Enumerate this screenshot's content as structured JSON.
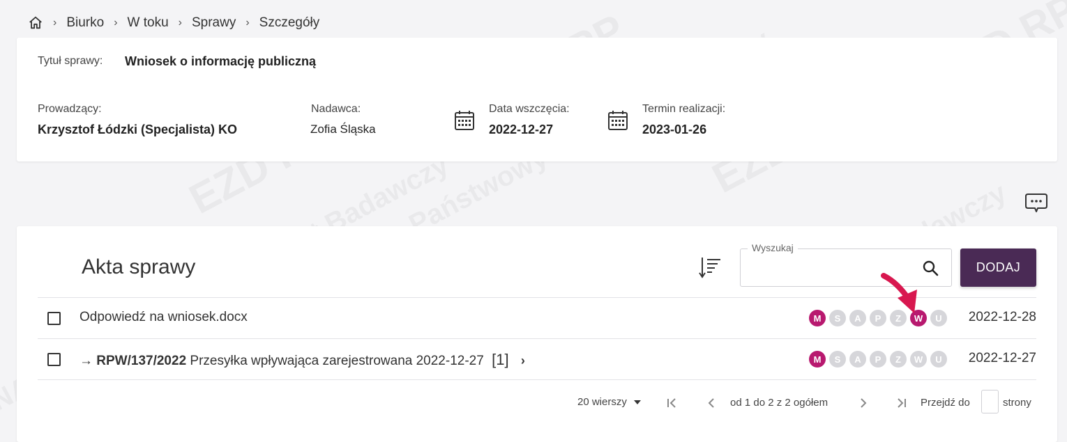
{
  "breadcrumb": {
    "items": [
      "Biurko",
      "W toku",
      "Sprawy",
      "Szczegóły"
    ]
  },
  "case": {
    "title_label": "Tytuł sprawy:",
    "title_value": "Wniosek o informację publiczną",
    "lead_label": "Prowadzący:",
    "lead_value": "Krzysztof Łódzki (Specjalista) KO",
    "sender_label": "Nadawca:",
    "sender_value": "Zofia Śląska",
    "start_label": "Data wszczęcia:",
    "start_value": "2022-12-27",
    "deadline_label": "Termin realizacji:",
    "deadline_value": "2023-01-26"
  },
  "files": {
    "title": "Akta sprawy",
    "search_label": "Wyszukaj",
    "search_value": "",
    "add_label": "DODAJ",
    "rows": [
      {
        "name": "Odpowiedź na wniosek.docx",
        "badges": [
          {
            "letter": "M",
            "active": true
          },
          {
            "letter": "S",
            "active": false
          },
          {
            "letter": "A",
            "active": false
          },
          {
            "letter": "P",
            "active": false
          },
          {
            "letter": "Z",
            "active": false
          },
          {
            "letter": "W",
            "active": true
          },
          {
            "letter": "U",
            "active": false
          }
        ],
        "date": "2022-12-28"
      },
      {
        "arrow": "→",
        "ref": "RPW/137/2022",
        "desc": "Przesyłka wpływająca zarejestrowana 2022-12-27",
        "count": "[1]",
        "chevron": "›",
        "badges": [
          {
            "letter": "M",
            "active": true
          },
          {
            "letter": "S",
            "active": false
          },
          {
            "letter": "A",
            "active": false
          },
          {
            "letter": "P",
            "active": false
          },
          {
            "letter": "Z",
            "active": false
          },
          {
            "letter": "W",
            "active": false
          },
          {
            "letter": "U",
            "active": false
          }
        ],
        "date": "2022-12-27"
      }
    ],
    "pager": {
      "rows_per_page": "20 wierszy",
      "range": "od 1 do 2 z 2 ogółem",
      "goto_label": "Przejdź do",
      "page_value": "",
      "page_suffix": "strony"
    }
  },
  "watermark": {
    "lines": [
      "NASK – Państwowy Instytut Badawczy",
      "EZD RP"
    ]
  },
  "colors": {
    "accent": "#4a2a55",
    "badge_active": "#b8196f",
    "badge_inactive": "#d6d6da",
    "annotation_arrow": "#d8174f"
  },
  "icons": {
    "home": "home-icon",
    "calendar": "calendar-icon",
    "chat": "chat-bubble-icon",
    "sort": "sort-icon",
    "search": "search-icon"
  }
}
